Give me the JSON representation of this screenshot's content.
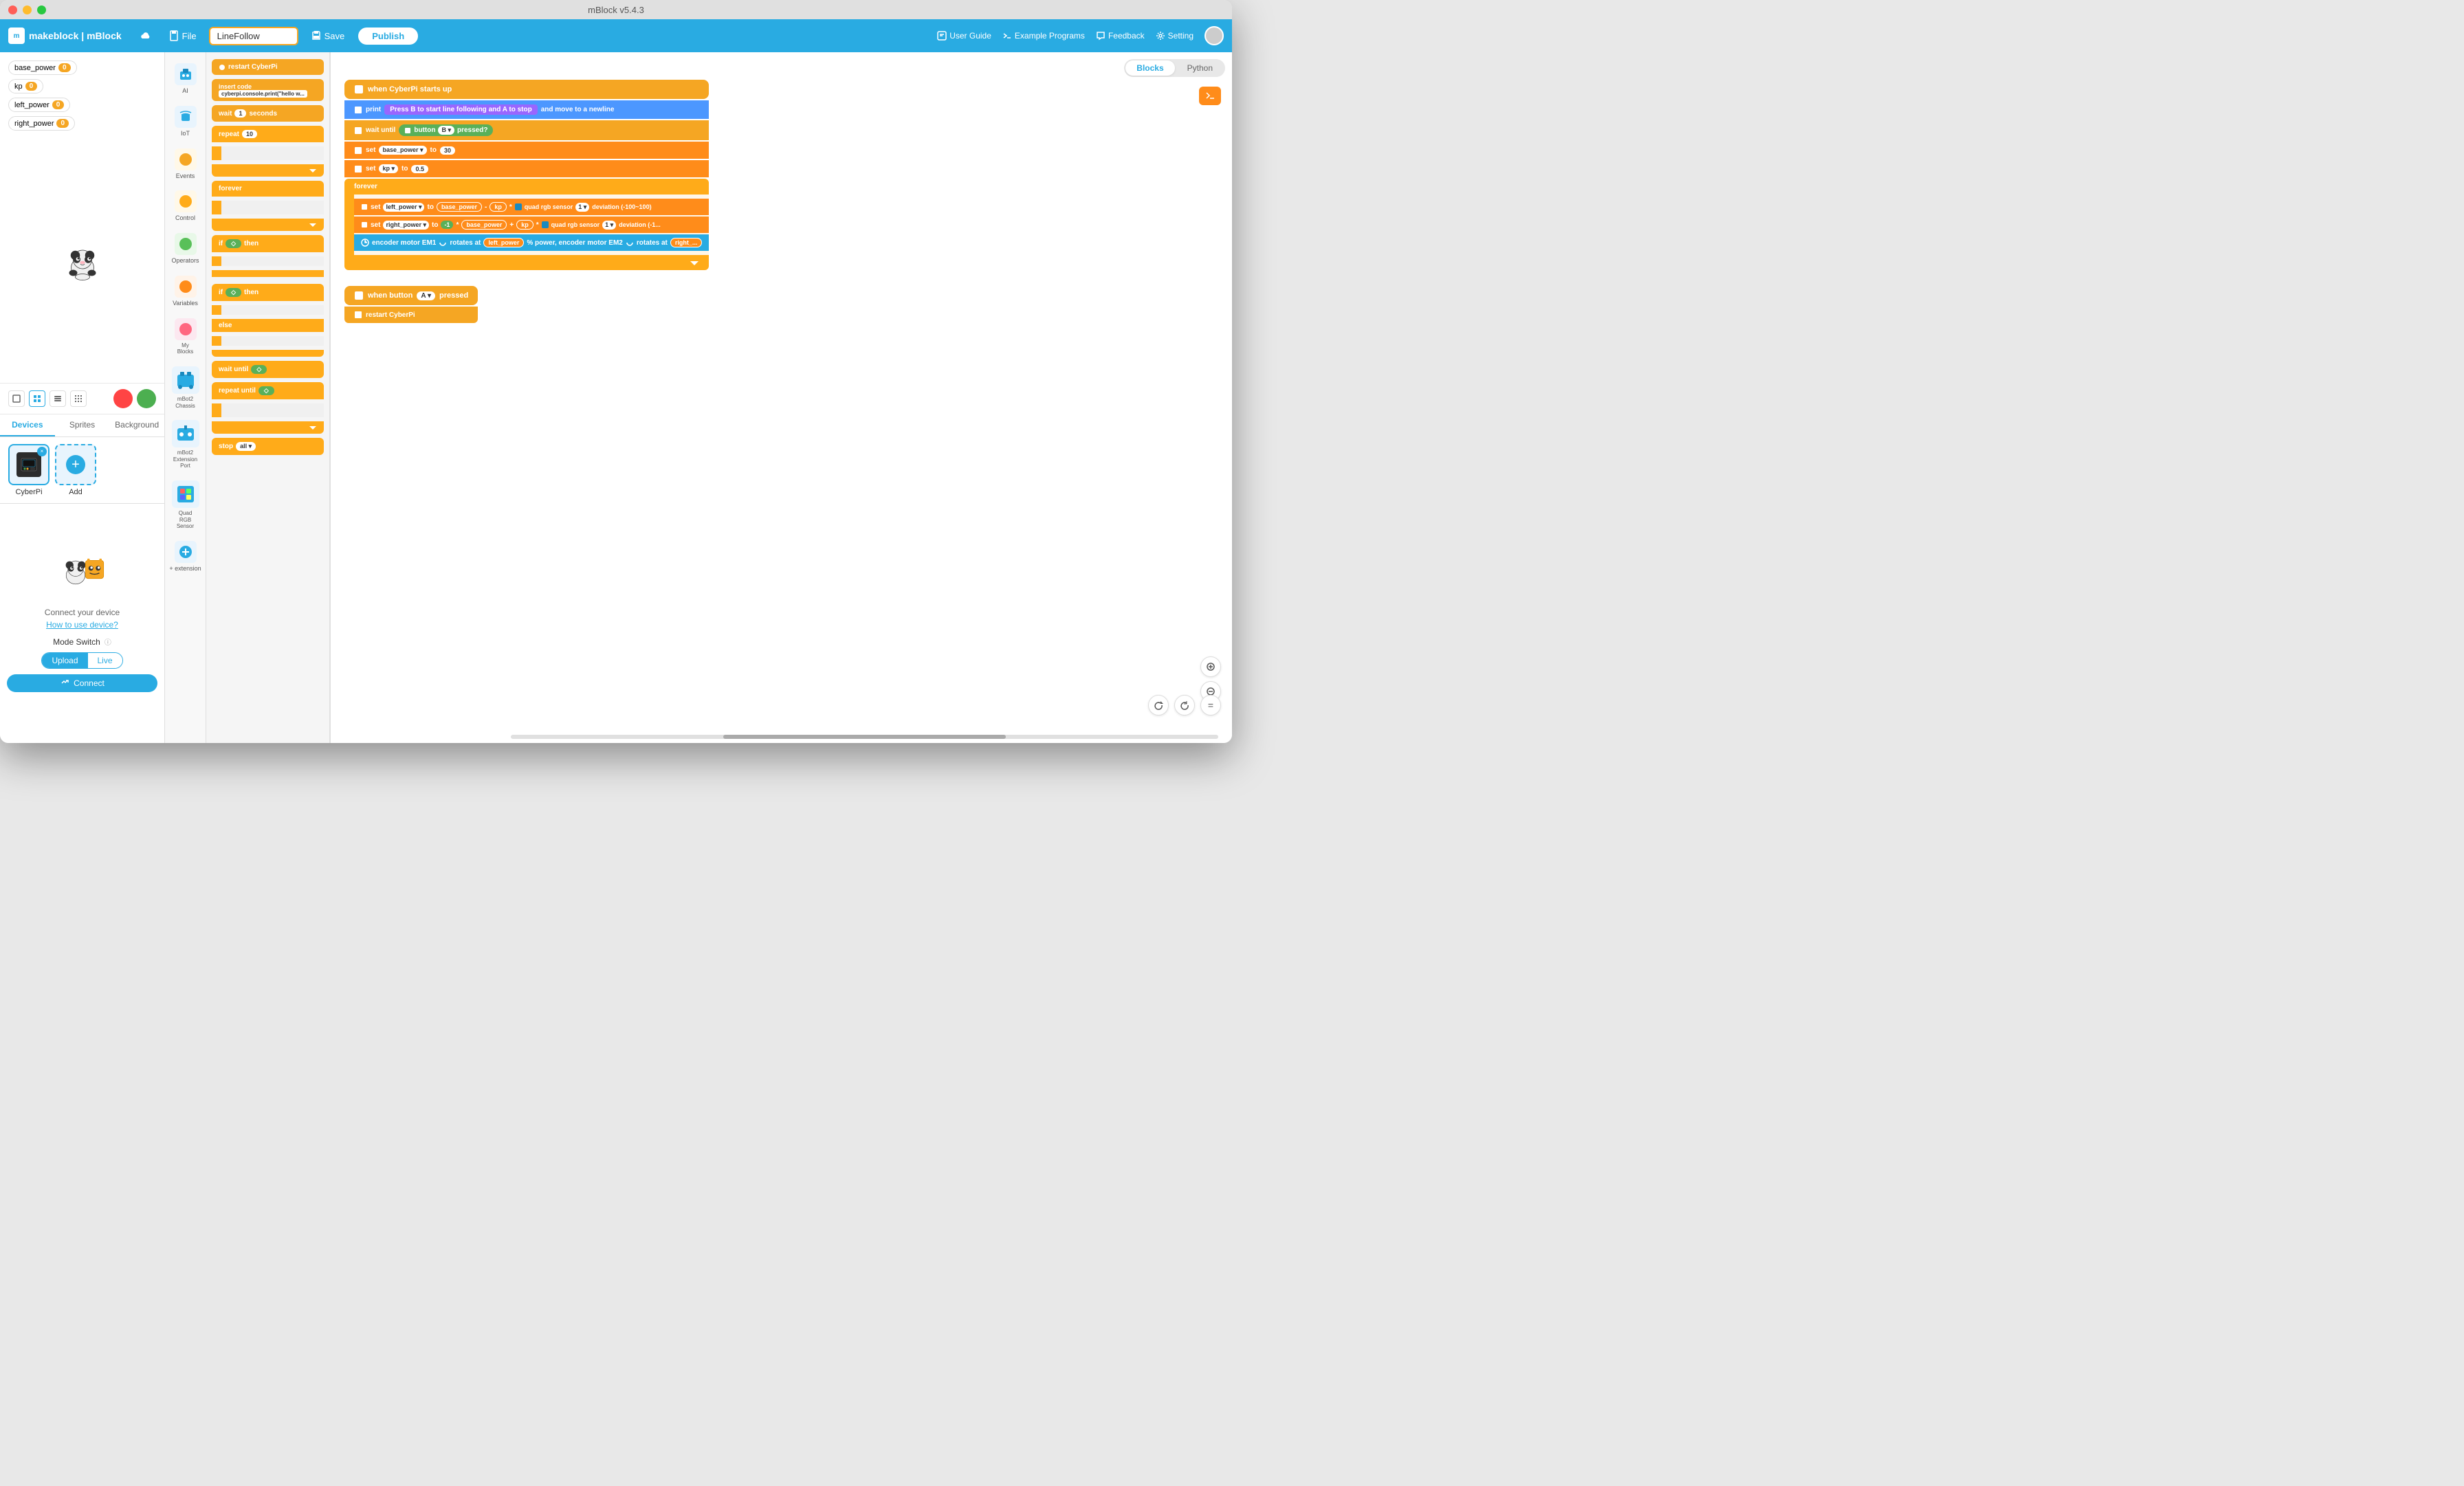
{
  "window": {
    "title": "mBlock v5.4.3"
  },
  "toolbar": {
    "brand": "makeblock | mBlock",
    "file_label": "File",
    "project_name": "LineFollow",
    "save_label": "Save",
    "publish_label": "Publish",
    "user_guide_label": "User Guide",
    "example_programs_label": "Example Programs",
    "feedback_label": "Feedback",
    "setting_label": "Setting"
  },
  "variables": [
    {
      "name": "base_power",
      "value": "0"
    },
    {
      "name": "kp",
      "value": "0"
    },
    {
      "name": "left_power",
      "value": "0"
    },
    {
      "name": "right_power",
      "value": "0"
    }
  ],
  "view_tabs": [
    {
      "id": "blocks",
      "label": "Blocks",
      "active": true
    },
    {
      "id": "python",
      "label": "Python",
      "active": false
    }
  ],
  "block_categories": [
    {
      "id": "ai",
      "label": "AI",
      "color": "#29abe2",
      "icon": "🤖"
    },
    {
      "id": "iot",
      "label": "IoT",
      "color": "#29abe2",
      "icon": "📡"
    },
    {
      "id": "events",
      "label": "Events",
      "color": "#f5a623",
      "icon": "⚡"
    },
    {
      "id": "control",
      "label": "Control",
      "color": "#f5a623",
      "icon": "🔄"
    },
    {
      "id": "operators",
      "label": "Operators",
      "color": "#59c059",
      "icon": "➕"
    },
    {
      "id": "variables",
      "label": "Variables",
      "color": "#ff8c1a",
      "icon": "📦"
    },
    {
      "id": "my_blocks",
      "label": "My\nBlocks",
      "color": "#ff6680",
      "icon": "🧩"
    },
    {
      "id": "mbot2_chassis",
      "label": "mBot2\nChassis",
      "color": "#29abe2",
      "icon": "🤖"
    },
    {
      "id": "mbot2_ext",
      "label": "mBot2\nExtension\nPort",
      "color": "#29abe2",
      "icon": "🔌"
    },
    {
      "id": "quad_rgb",
      "label": "Quad\nRGB\nSensor",
      "color": "#29abe2",
      "icon": "🎨"
    },
    {
      "id": "extension",
      "label": "+ extension",
      "color": "#29abe2",
      "icon": "➕"
    }
  ],
  "editor_blocks": [
    {
      "type": "restart",
      "label": "restart CyberPi",
      "color": "#f5a623"
    },
    {
      "type": "insert_code",
      "label": "insert code  cyberpi.console.print(\"hello w...",
      "color": "#f5a623"
    },
    {
      "type": "wait",
      "label": "wait  1  seconds",
      "color": "#f5a623"
    },
    {
      "type": "repeat",
      "label": "repeat  10",
      "color": "#ffab19"
    },
    {
      "type": "forever",
      "label": "forever",
      "color": "#ffab19"
    },
    {
      "type": "if_then",
      "label": "if   then",
      "color": "#ffab19"
    },
    {
      "type": "if_then2",
      "label": "if   then",
      "color": "#ffab19"
    },
    {
      "type": "else",
      "label": "else",
      "color": "#ffab19"
    },
    {
      "type": "wait_until",
      "label": "wait until",
      "color": "#ffab19"
    },
    {
      "type": "repeat_until",
      "label": "repeat until",
      "color": "#ffab19"
    },
    {
      "type": "stop",
      "label": "stop  all ▾",
      "color": "#ffab19"
    }
  ],
  "code_blocks": {
    "script1": {
      "type": "when_starts_up",
      "label": "when CyberPi starts up",
      "children": [
        {
          "type": "print",
          "label": "print",
          "text": "Press B to start line following and A to stop",
          "suffix": "and move to a newline"
        },
        {
          "type": "wait_until",
          "label": "wait until",
          "condition": "button B ▾ pressed?"
        },
        {
          "type": "set",
          "label": "set base_power ▾ to",
          "value": "30"
        },
        {
          "type": "set",
          "label": "set kp ▾ to",
          "value": "0.5"
        },
        {
          "type": "forever",
          "label": "forever",
          "children": [
            {
              "type": "set_complex",
              "label": "set left_power ▾ to",
              "expr": "base_power - kp * quad rgb sensor 1 ▾ deviation (-100~100)"
            },
            {
              "type": "set_complex",
              "label": "set right_power ▾ to",
              "expr": "-1 * base_power + kp * quad rgb sensor 1 ▾ deviation (-100..."
            },
            {
              "type": "encoder",
              "label": "encoder motor EM1 ↻ rotates at left_power % power, encoder motor EM2 ↻ rotates at right_..."
            }
          ]
        }
      ]
    },
    "script2": {
      "type": "when_button",
      "label": "when button A ▾ pressed",
      "children": [
        {
          "type": "restart",
          "label": "restart CyberPi"
        }
      ]
    }
  },
  "sprites": {
    "devices": [
      {
        "name": "CyberPi",
        "selected": true
      }
    ],
    "sprites_list": [
      {
        "name": "Panda"
      }
    ]
  },
  "tabs": {
    "devices": "Devices",
    "sprites": "Sprites",
    "background": "Background"
  },
  "connect_area": {
    "connect_text": "Connect your device",
    "how_to_use": "How to use device?",
    "mode_switch_label": "Mode Switch",
    "upload_label": "Upload",
    "live_label": "Live",
    "connect_btn_label": "Connect"
  },
  "bottom_controls": {
    "zoom_in": "+",
    "zoom_out": "-",
    "reset": "↺"
  }
}
